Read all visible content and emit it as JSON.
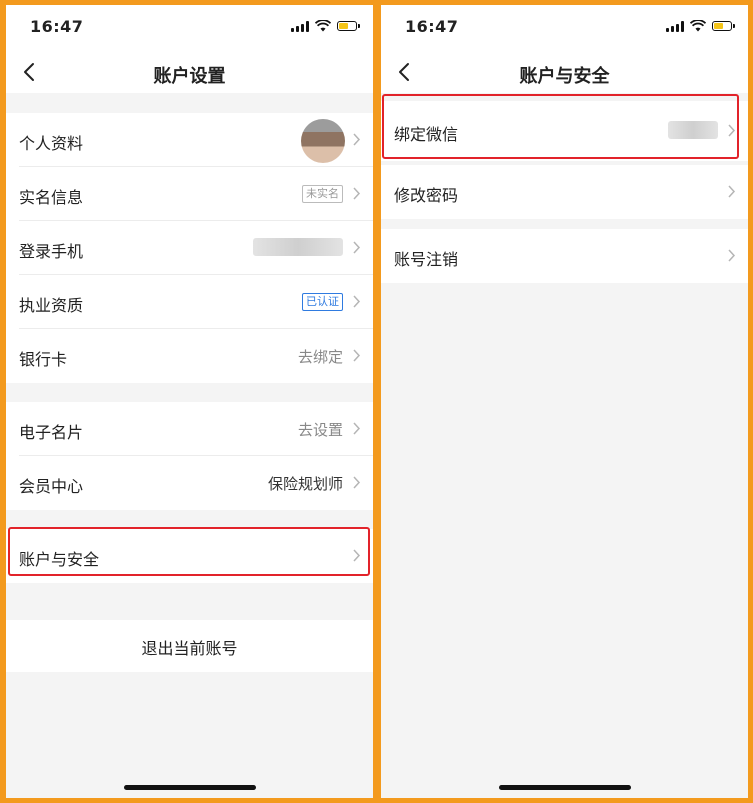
{
  "left": {
    "status_time": "16:47",
    "nav_title": "账户设置",
    "group1": [
      {
        "label": "个人资料",
        "kind": "avatar"
      },
      {
        "label": "实名信息",
        "tag": "未实名"
      },
      {
        "label": "登录手机",
        "kind": "blurred"
      },
      {
        "label": "执业资质",
        "tag": "已认证"
      },
      {
        "label": "银行卡",
        "value": "去绑定"
      }
    ],
    "group2": [
      {
        "label": "电子名片",
        "value": "去设置"
      },
      {
        "label": "会员中心",
        "value": "保险规划师"
      }
    ],
    "account_security": "账户与安全",
    "logout": "退出当前账号"
  },
  "right": {
    "status_time": "16:47",
    "nav_title": "账户与安全",
    "rows": [
      {
        "label": "绑定微信",
        "kind": "blurred"
      },
      {
        "label": "修改密码"
      },
      {
        "label": "账号注销"
      }
    ]
  },
  "colors": {
    "frame": "#f39a1e",
    "highlight": "#e2232a",
    "verified": "#2f7be0",
    "battery": "#f5c518"
  }
}
